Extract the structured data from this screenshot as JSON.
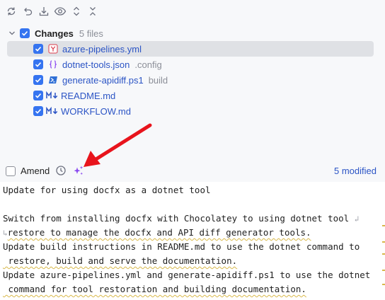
{
  "toolbar": {
    "buttons": [
      {
        "name": "refresh-icon"
      },
      {
        "name": "rollback-icon"
      },
      {
        "name": "download-icon"
      },
      {
        "name": "eye-icon"
      },
      {
        "name": "expand-all-icon"
      },
      {
        "name": "collapse-all-icon"
      }
    ]
  },
  "changes": {
    "label": "Changes",
    "count": "5 files",
    "files": [
      {
        "name": "azure-pipelines.yml",
        "hint": "",
        "icon": "yaml-icon",
        "selected": true
      },
      {
        "name": "dotnet-tools.json",
        "hint": ".config",
        "icon": "json-icon",
        "selected": false
      },
      {
        "name": "generate-apidiff.ps1",
        "hint": "build",
        "icon": "powershell-icon",
        "selected": false
      },
      {
        "name": "README.md",
        "hint": "",
        "icon": "markdown-icon",
        "selected": false
      },
      {
        "name": "WORKFLOW.md",
        "hint": "",
        "icon": "markdown-icon",
        "selected": false
      }
    ]
  },
  "commit": {
    "amend_label": "Amend",
    "modified_label": "5 modified",
    "message_lines": [
      "Update for using docfx as a dotnet tool",
      "",
      "Switch from installing docfx with Chocolatey to using dotnet tool",
      "restore to manage the docfx and API diff generator tools.",
      "Update build instructions in README.md to use the dotnet command to",
      " restore, build and serve the documentation.",
      "Update azure-pipelines.yml and generate-apidiff.ps1 to use the dotnet",
      " command for tool restoration and building documentation."
    ]
  },
  "colors": {
    "accent": "#3574f0",
    "link": "#2b54c5",
    "arrow": "#e8141c",
    "sparkle": "#8b4bf0"
  }
}
